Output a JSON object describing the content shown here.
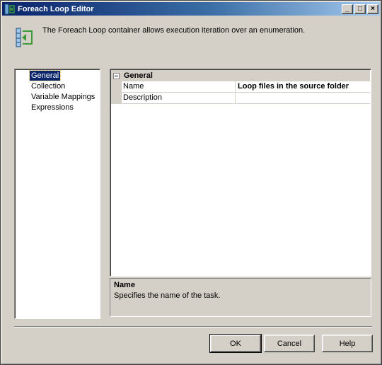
{
  "window": {
    "title": "Foreach Loop Editor",
    "minimize": "_",
    "maximize": "□",
    "close": "×"
  },
  "header": {
    "description": "The Foreach Loop container allows execution iteration over an enumeration."
  },
  "nav": {
    "items": [
      {
        "label": "General",
        "selected": true
      },
      {
        "label": "Collection",
        "selected": false
      },
      {
        "label": "Variable Mappings",
        "selected": false
      },
      {
        "label": "Expressions",
        "selected": false
      }
    ]
  },
  "grid": {
    "category": "General",
    "properties": [
      {
        "name": "Name",
        "value": "Loop files in the source folder"
      },
      {
        "name": "Description",
        "value": ""
      }
    ]
  },
  "help": {
    "title": "Name",
    "text": "Specifies the name of the task."
  },
  "buttons": {
    "ok": "OK",
    "cancel": "Cancel",
    "help": "Help"
  },
  "colors": {
    "title_bar": "#0a246a",
    "face": "#d4d0c8",
    "selection": "#0a246a"
  },
  "icons": {
    "title": "foreach-loop-icon",
    "header": "foreach-container-icon"
  }
}
